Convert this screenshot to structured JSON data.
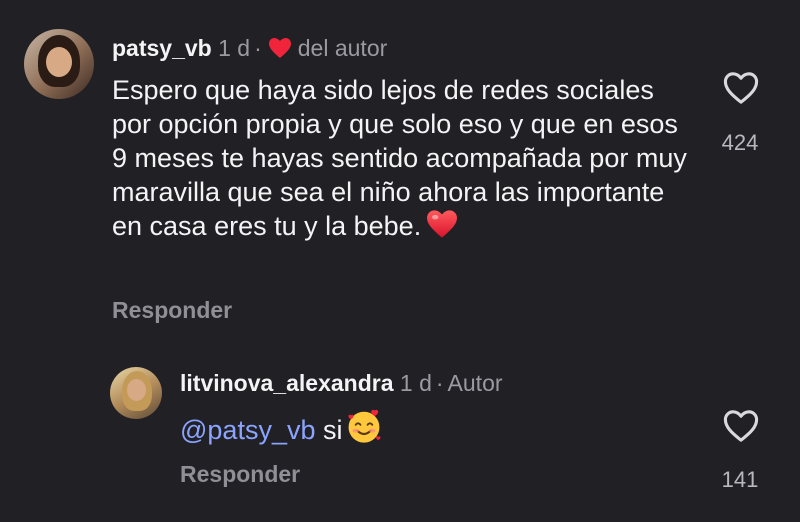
{
  "comment": {
    "username": "patsy_vb",
    "age": "1 d",
    "separator": "·",
    "liked_by_author": "del autor",
    "text": "Espero que haya sido lejos de redes sociales por opción propia y que solo eso y que en esos 9 meses te hayas sentido acompañada por muy maravilla que sea el niño ahora las importante en casa eres tu y la bebe.",
    "reply_label": "Responder",
    "likes": "424"
  },
  "reply": {
    "username": "litvinova_alexandra",
    "age": "1 d",
    "separator": "·",
    "badge": "Autor",
    "mention": "@patsy_vb",
    "text": "si",
    "reply_label": "Responder",
    "likes": "141"
  },
  "icons": {
    "like": "heart-outline-icon",
    "author_like": "red-heart-icon",
    "emoji_heart": "red-heart-emoji",
    "emoji_smile": "smiling-face-with-hearts-emoji"
  },
  "colors": {
    "background": "#212125",
    "heart_red": "#f0243a",
    "mention_blue": "#8ba4ff"
  }
}
